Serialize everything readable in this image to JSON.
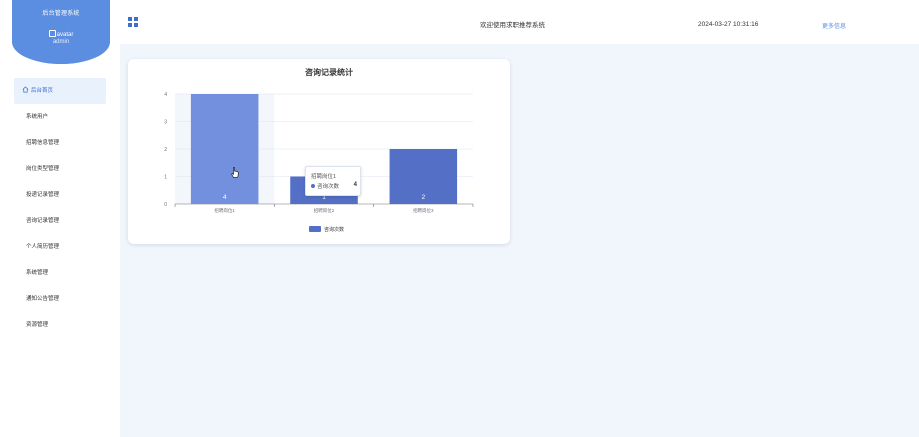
{
  "sidebar": {
    "brand_title": "后台管理系统",
    "avatar_alt": "avatar",
    "username": "admin",
    "items": [
      {
        "label": "后台首页",
        "active": true
      },
      {
        "label": "系统用户",
        "active": false
      },
      {
        "label": "招聘信息管理",
        "active": false
      },
      {
        "label": "岗位类型管理",
        "active": false
      },
      {
        "label": "投递记录管理",
        "active": false
      },
      {
        "label": "咨询记录管理",
        "active": false
      },
      {
        "label": "个人简历管理",
        "active": false
      },
      {
        "label": "系统管理",
        "active": false
      },
      {
        "label": "通知公告管理",
        "active": false
      },
      {
        "label": "资源管理",
        "active": false
      }
    ]
  },
  "header": {
    "welcome": "欢迎使用求职推荐系统",
    "datetime": "2024-03-27 10:31:16",
    "more_link": "更多信息"
  },
  "colors": {
    "accent": "#5b8de0",
    "bar": "#5470c6",
    "bar_hover": "#7390de",
    "main_bg": "#f1f6fd"
  },
  "chart_data": {
    "type": "bar",
    "title": "咨询记录统计",
    "categories": [
      "招聘岗位1",
      "招聘岗位2",
      "招聘岗位3"
    ],
    "series": [
      {
        "name": "咨询次数",
        "values": [
          4,
          1,
          2
        ]
      }
    ],
    "ylim": [
      0,
      4
    ],
    "yticks": [
      "0",
      "1",
      "2",
      "3",
      "4"
    ],
    "grid": true,
    "legend": "bottom-center",
    "highlighted_index": 0
  },
  "tooltip": {
    "title": "招聘岗位1",
    "series_name": "咨询次数",
    "value": "4"
  }
}
